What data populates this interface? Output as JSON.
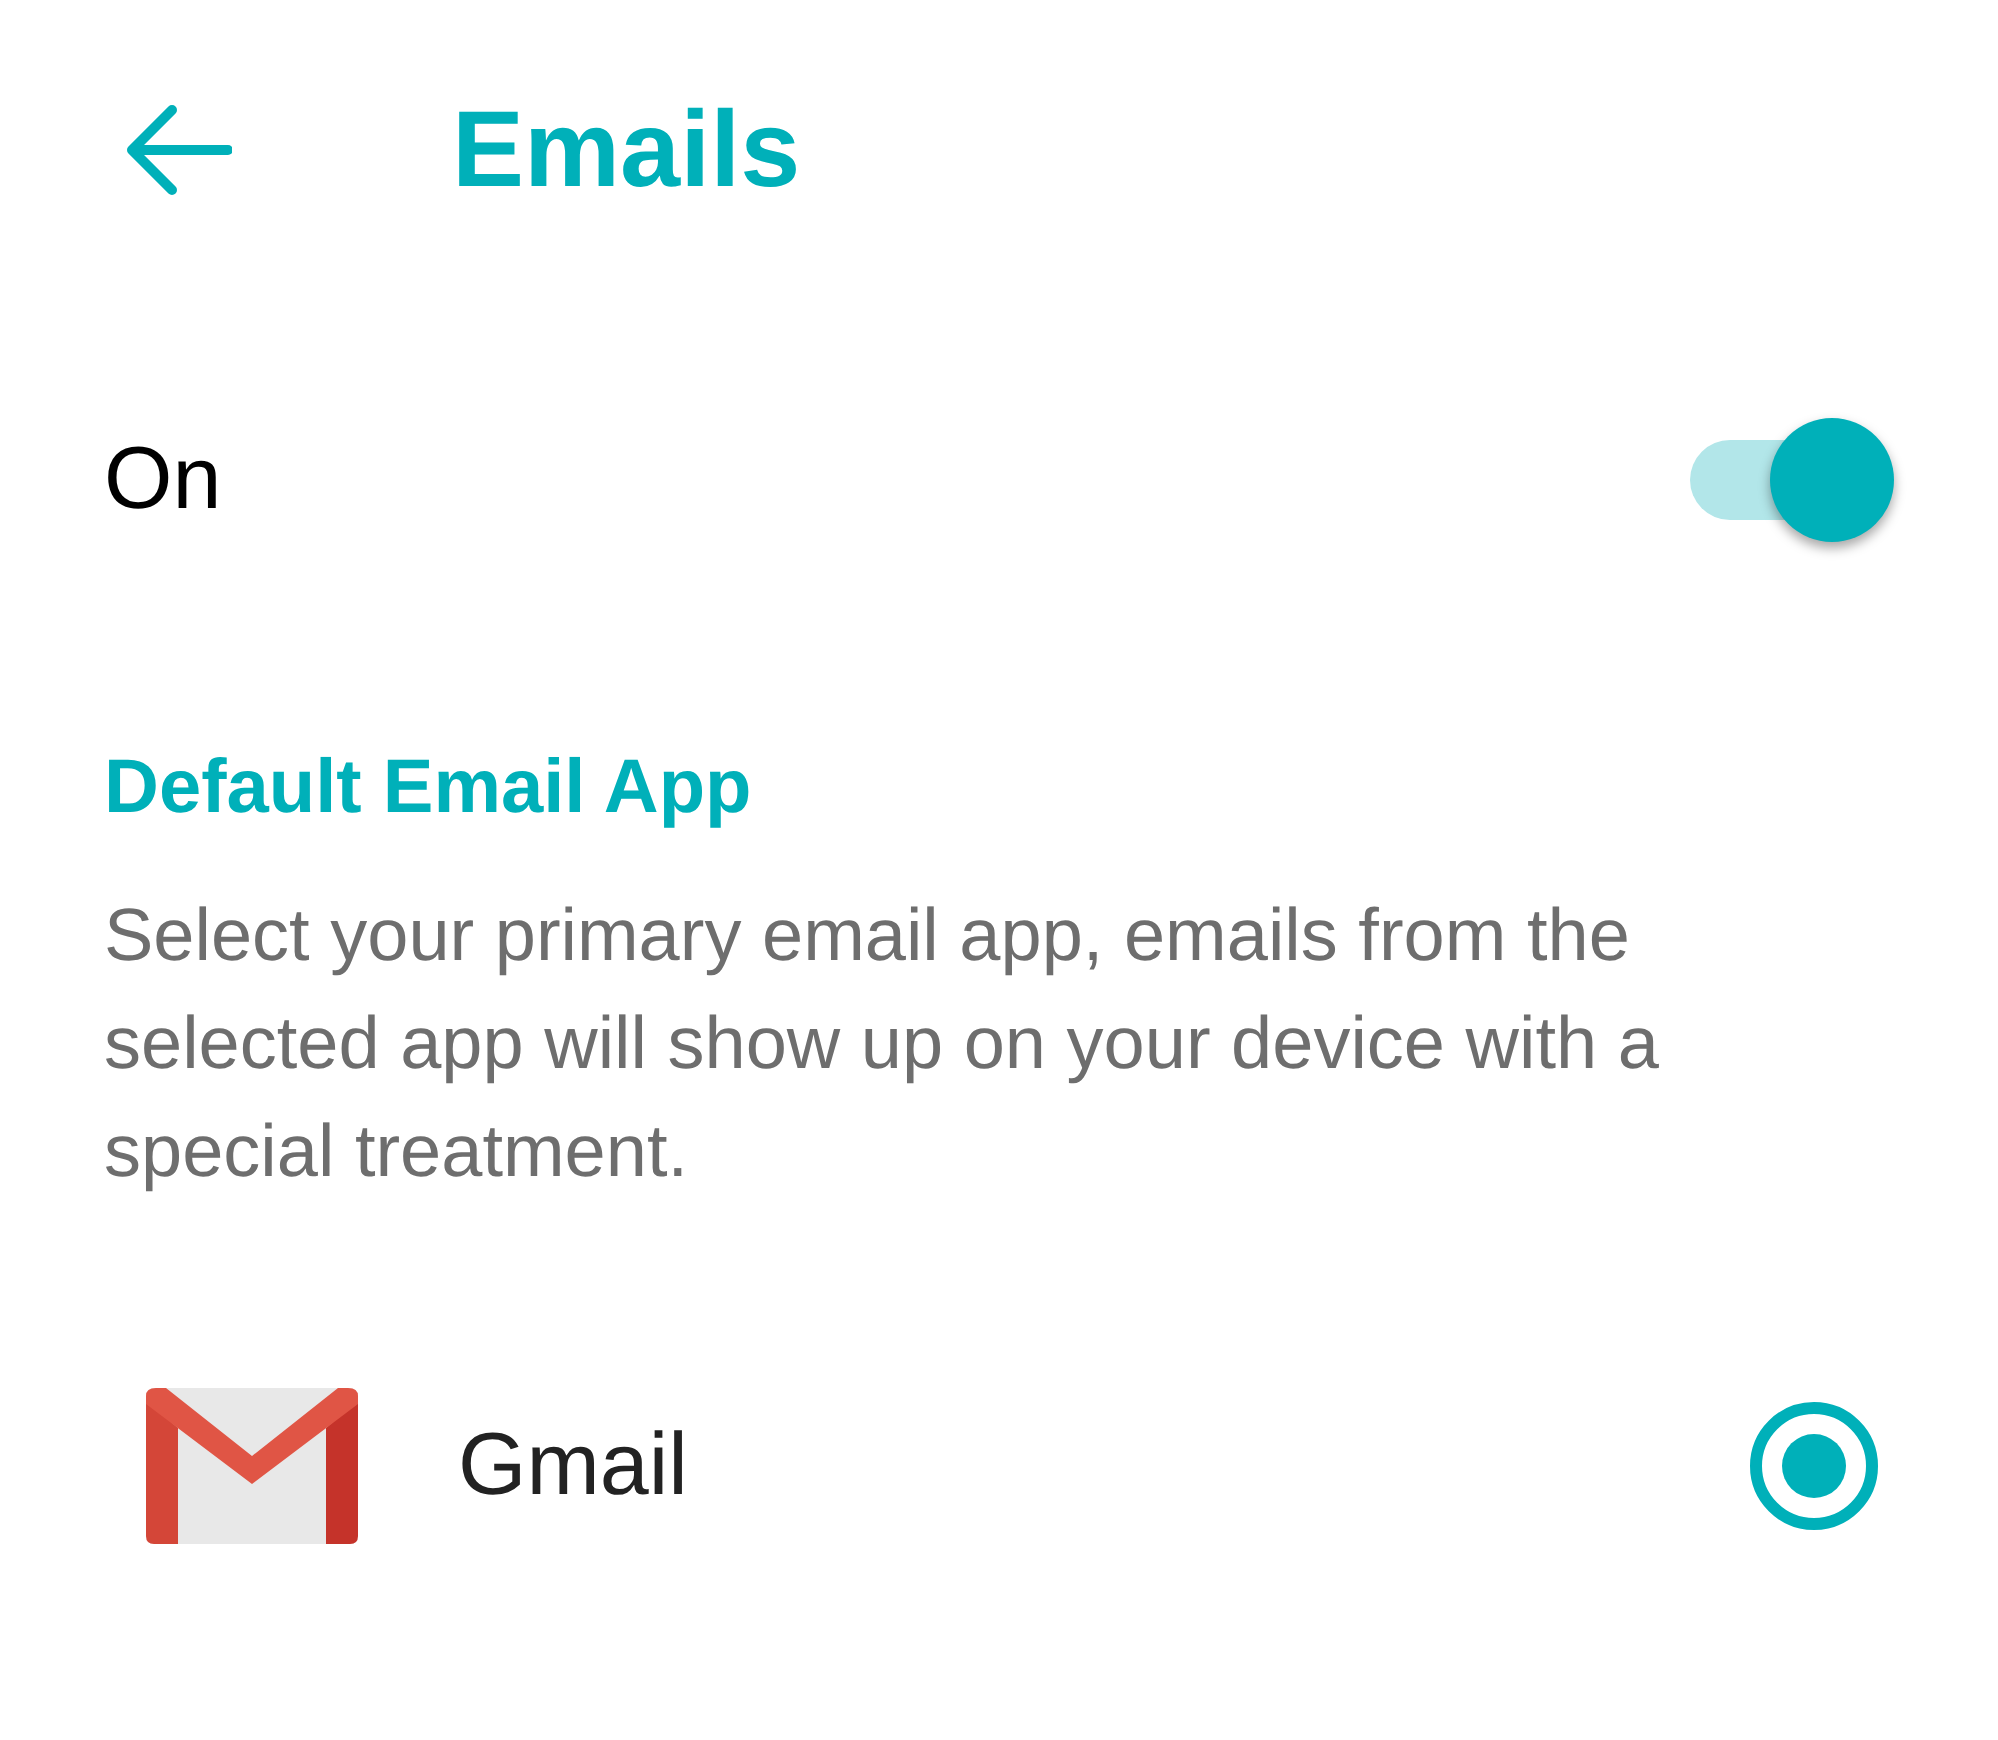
{
  "header": {
    "title": "Emails"
  },
  "toggle": {
    "label": "On",
    "on": true
  },
  "section": {
    "heading": "Default Email App",
    "description": "Select your primary email app, emails from the selected app will show up on your device with a special treatment."
  },
  "apps": [
    {
      "name": "Gmail",
      "selected": true
    }
  ]
}
